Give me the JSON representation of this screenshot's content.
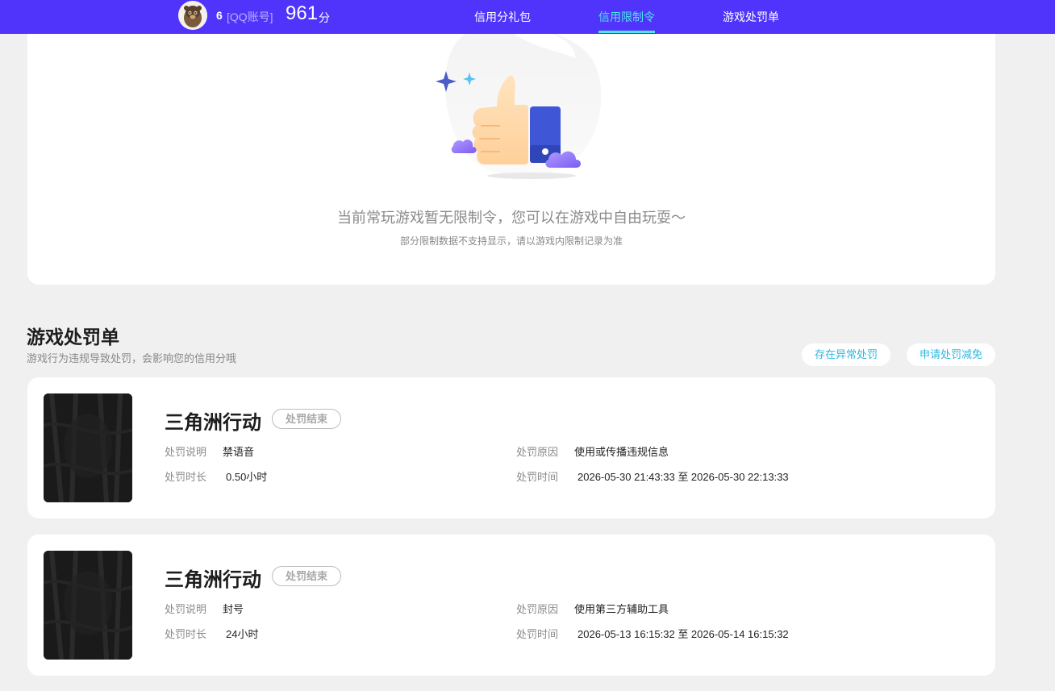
{
  "header": {
    "level": "6",
    "account_type": "[QQ账号]",
    "score": "961",
    "score_unit": "分",
    "nav": [
      {
        "label": "信用分礼包"
      },
      {
        "label": "信用限制令"
      },
      {
        "label": "游戏处罚单"
      }
    ],
    "active_nav": "信用限制令",
    "colors": {
      "bar": "#5134fb",
      "active": "#50e3f0"
    }
  },
  "restriction": {
    "empty_title": "当前常玩游戏暂无限制令，您可以在游戏中自由玩耍～",
    "empty_subtitle": "部分限制数据不支持显示，请以游戏内限制记录为准",
    "illustration_icon": "thumbs-up-icon"
  },
  "penalty_section": {
    "title": "游戏处罚单",
    "subtitle": "游戏行为违规导致处罚，会影响您的信用分哦",
    "actions": [
      {
        "label": "存在异常处罚"
      },
      {
        "label": "申请处罚减免"
      }
    ],
    "field_labels": {
      "desc": "处罚说明",
      "duration": "处罚时长",
      "reason": "处罚原因",
      "time": "处罚时间"
    },
    "records": [
      {
        "game": "三角洲行动",
        "status": "处罚结束",
        "desc": "禁语音",
        "duration": "0.50小时",
        "reason": "使用或传播违规信息",
        "time": "2026-05-30 21:43:33 至 2026-05-30 22:13:33"
      },
      {
        "game": "三角洲行动",
        "status": "处罚结束",
        "desc": "封号",
        "duration": "24小时",
        "reason": "使用第三方辅助工具",
        "time": "2026-05-13 16:15:32 至 2026-05-14 16:15:32"
      }
    ]
  }
}
